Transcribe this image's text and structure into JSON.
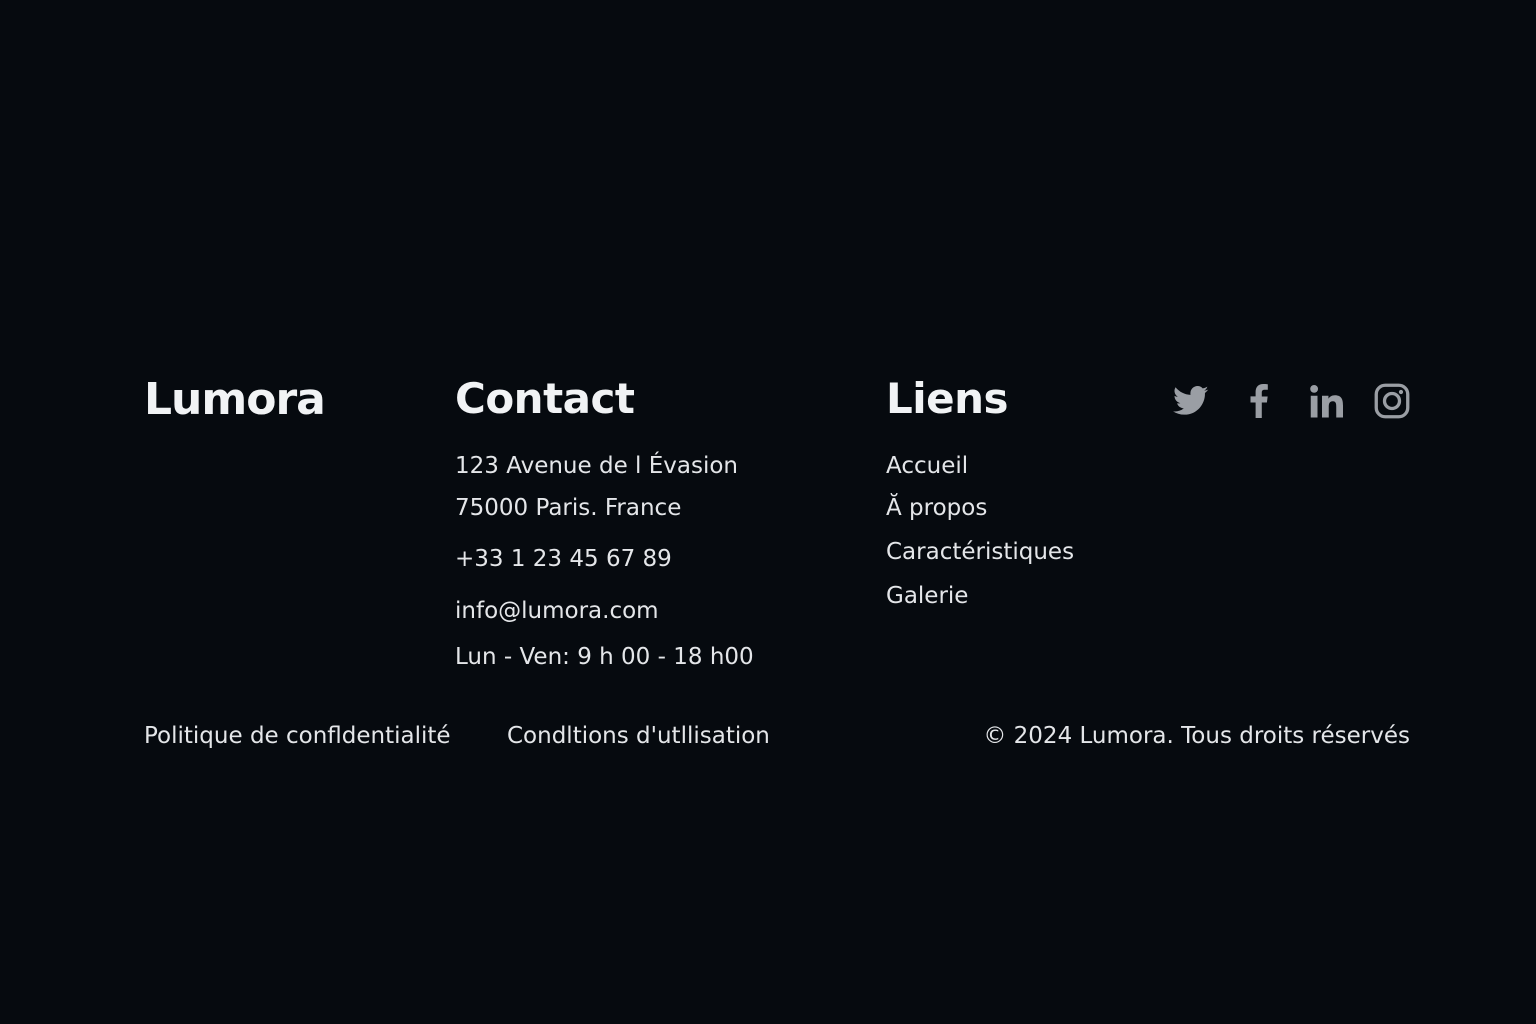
{
  "brand": {
    "name": "Lumora"
  },
  "contact": {
    "title": "Contact",
    "address_line1": "123 Avenue de l Évasion",
    "address_line2": "75000 Paris. France",
    "phone": "+33 1 23 45 67 89",
    "email": "info@lumora.com",
    "hours": "Lun - Ven: 9 h 00 - 18 h00"
  },
  "links": {
    "title": "Liens",
    "items": [
      {
        "label": "Accueil"
      },
      {
        "label": "Ă propos"
      },
      {
        "label": "Caractéristiques"
      },
      {
        "label": "Galerie"
      }
    ]
  },
  "social": {
    "icons": [
      "twitter-icon",
      "facebook-icon",
      "linkedin-icon",
      "instagram-icon"
    ],
    "icon_color": "#9a9ea4"
  },
  "legal": {
    "privacy_label": "Politique de confldentialité",
    "terms_label": "Condltions d'utllisation",
    "copyright": "© 2024 Lumora. Tous droits réservés"
  },
  "colors": {
    "background": "#060a0f",
    "text": "#e8eaed"
  }
}
